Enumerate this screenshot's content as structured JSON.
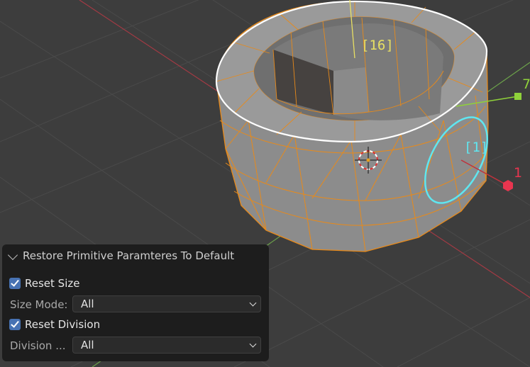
{
  "viewport": {
    "vertex_count_label": "[16]",
    "selected_count_label": "[1]",
    "gizmo_y_label": "7",
    "gizmo_x_label": "1"
  },
  "panel": {
    "title": "Restore Primitive Paramteres To Default",
    "reset_size_label": "Reset Size",
    "reset_size_checked": true,
    "size_mode_label": "Size Mode:",
    "size_mode_value": "All",
    "reset_division_label": "Reset Division",
    "reset_division_checked": true,
    "division_label": "Division ...",
    "division_value": "All"
  },
  "colors": {
    "background": "#3d3d3d",
    "mesh_fill": "#8a8a8a",
    "edge_select": "#e88a1a",
    "ring_highlight": "#ffffff",
    "cyan_circle": "#5fe6f0",
    "checkbox": "#4772b3",
    "axis_red": "#c0323c",
    "axis_green": "#6ca24a"
  }
}
